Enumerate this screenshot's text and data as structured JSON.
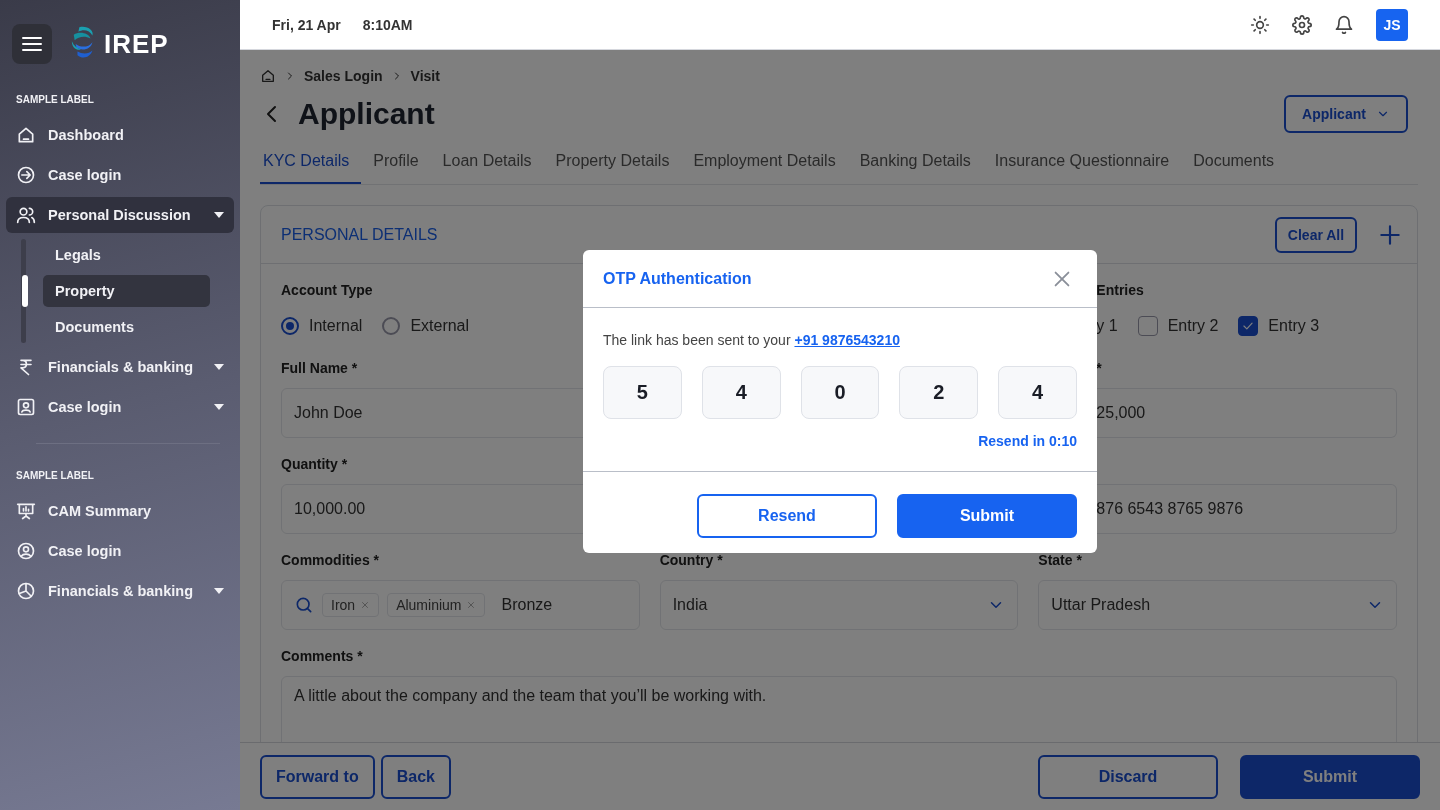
{
  "sidebar": {
    "logo": "IREP",
    "sections": [
      {
        "label": "SAMPLE LABEL",
        "items": [
          {
            "label": "Dashboard",
            "kind": "link",
            "selected": false
          },
          {
            "label": "Case login",
            "kind": "link",
            "selected": false
          },
          {
            "label": "Personal Discussion",
            "kind": "group",
            "selected": true,
            "children": [
              {
                "label": "Legals",
                "selected": false
              },
              {
                "label": "Property",
                "selected": true
              },
              {
                "label": "Documents",
                "selected": false
              }
            ]
          },
          {
            "label": "Financials & banking",
            "kind": "group",
            "selected": false
          },
          {
            "label": "Case login",
            "kind": "group",
            "selected": false
          }
        ]
      },
      {
        "label": "SAMPLE LABEL",
        "items": [
          {
            "label": "CAM Summary",
            "kind": "link",
            "selected": false
          },
          {
            "label": "Case login",
            "kind": "link",
            "selected": false
          },
          {
            "label": "Financials & banking",
            "kind": "group",
            "selected": false
          }
        ]
      }
    ]
  },
  "header": {
    "date": "Fri, 21 Apr",
    "time": "8:10AM",
    "avatar": "JS"
  },
  "page": {
    "breadcrumb": [
      "Sales Login",
      "Visit"
    ],
    "title": "Applicant",
    "role_menu": "Applicant",
    "tabs": [
      {
        "label": "KYC Details",
        "selected": true
      },
      {
        "label": "Profile",
        "selected": false
      },
      {
        "label": "Loan Details",
        "selected": false
      },
      {
        "label": "Property Details",
        "selected": false
      },
      {
        "label": "Employment Details",
        "selected": false
      },
      {
        "label": "Banking Details",
        "selected": false
      },
      {
        "label": "Insurance Questionnaire",
        "selected": false
      },
      {
        "label": "Documents",
        "selected": false
      }
    ],
    "card": {
      "title": "PERSONAL DETAILS",
      "clear_button": "Clear All",
      "rows": [
        {
          "left": {
            "kind": "radio",
            "label": "Account Type",
            "options": [
              {
                "label": "Internal",
                "selected": true
              },
              {
                "label": "External",
                "selected": false
              }
            ]
          },
          "right": {
            "kind": "checkbox",
            "label": "Entries",
            "options": [
              {
                "label": "y 1"
              },
              {
                "label": "Entry 2",
                "checked": false
              },
              {
                "label": "Entry 3",
                "checked": true
              }
            ]
          }
        },
        {
          "left": {
            "kind": "input",
            "label": "Full Name *",
            "value": "John Doe"
          },
          "right": {
            "kind": "input",
            "label": "*",
            "value": "25,000"
          }
        },
        {
          "left": {
            "kind": "input",
            "label": "Quantity *",
            "value": "10,000.00"
          },
          "right": {
            "kind": "input",
            "value": "876 6543 8765 9876"
          }
        },
        {
          "left": {
            "kind": "tags",
            "label": "Commodities *",
            "tags": [
              "Iron",
              "Aluminium"
            ],
            "value": "Bronze"
          },
          "middle": {
            "kind": "select",
            "label": "Country *",
            "value": "India"
          },
          "right": {
            "kind": "select",
            "label": "State *",
            "value": "Uttar Pradesh"
          }
        },
        {
          "full": {
            "kind": "textarea",
            "label": "Comments *",
            "value": "A little about the company and the team that you’ll be working with."
          }
        }
      ]
    },
    "footer": {
      "left": [
        "Forward to",
        "Back"
      ],
      "right": [
        {
          "label": "Discard",
          "kind": "outline"
        },
        {
          "label": "Submit",
          "kind": "primary"
        }
      ]
    }
  },
  "otp_modal": {
    "title": "OTP Authentication",
    "message": "The link has been sent to your",
    "phone": "+91 9876543210",
    "digits": [
      "5",
      "4",
      "0",
      "2",
      "4"
    ],
    "timer": "Resend in 0:10",
    "buttons": [
      {
        "label": "Resend",
        "kind": "outline"
      },
      {
        "label": "Submit",
        "kind": "primary"
      }
    ]
  }
}
